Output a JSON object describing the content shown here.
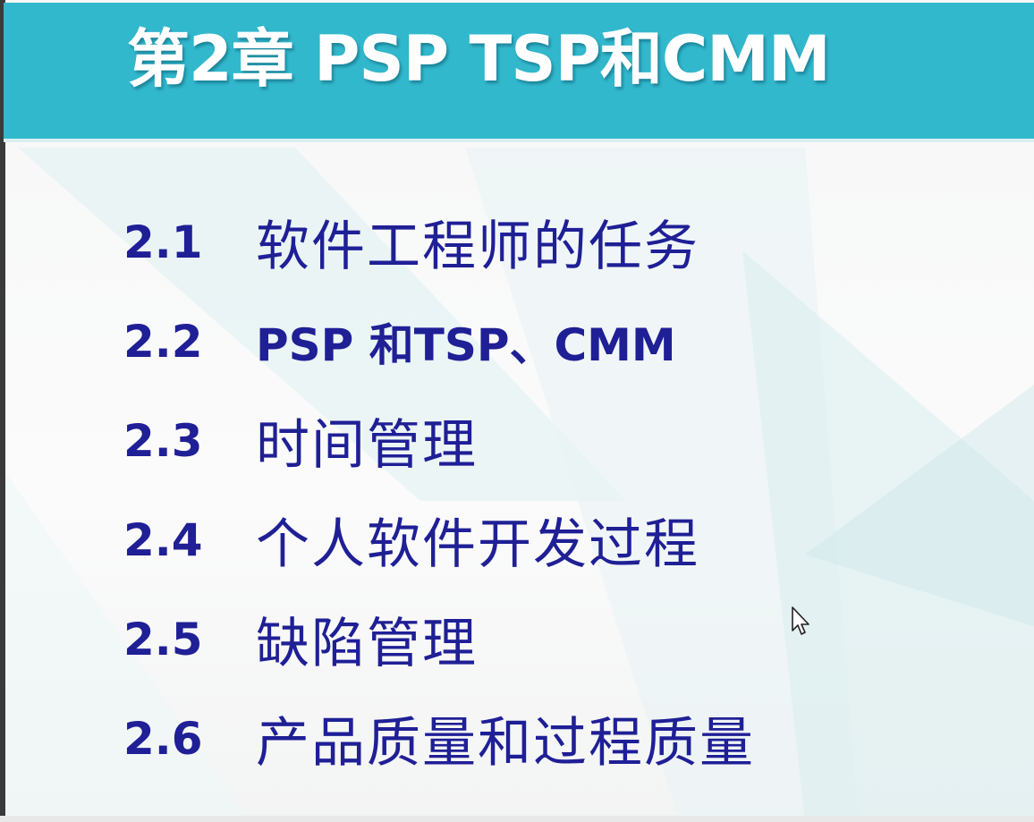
{
  "slide": {
    "title": "第2章 PSP TSP和CMM",
    "accent_color": "#32b8cd",
    "text_color": "#1f1f96"
  },
  "toc": {
    "items": [
      {
        "number": "2.1",
        "label": "软件工程师的任务"
      },
      {
        "number": "2.2",
        "label": "PSP 和TSP、CMM"
      },
      {
        "number": "2.3",
        "label": "时间管理"
      },
      {
        "number": "2.4",
        "label": "个人软件开发过程"
      },
      {
        "number": "2.5",
        "label": "缺陷管理"
      },
      {
        "number": "2.6",
        "label": "产品质量和过程质量"
      }
    ]
  },
  "cursor": {
    "icon": "mouse-pointer-icon"
  }
}
